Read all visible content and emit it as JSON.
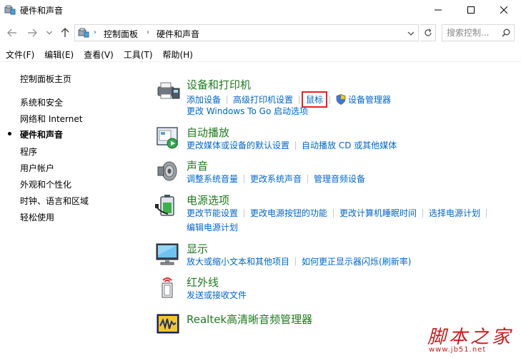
{
  "window": {
    "title": "硬件和声音"
  },
  "address": {
    "crumbs": [
      "控制面板",
      "硬件和声音"
    ],
    "search_placeholder": "搜索控制..."
  },
  "menu": [
    "文件(F)",
    "编辑(E)",
    "查看(V)",
    "工具(T)",
    "帮助(H)"
  ],
  "sidebar": {
    "home": "控制面板主页",
    "items": [
      {
        "label": "系统和安全"
      },
      {
        "label": "网络和 Internet"
      },
      {
        "label": "硬件和声音",
        "active": true
      },
      {
        "label": "程序"
      },
      {
        "label": "用户帐户"
      },
      {
        "label": "外观和个性化"
      },
      {
        "label": "时钟、语言和区域"
      },
      {
        "label": "轻松使用"
      }
    ]
  },
  "categories": [
    {
      "title": "设备和打印机",
      "icon": "printer-icon",
      "rows": [
        [
          "添加设备",
          "高级打印机设置",
          "鼠标",
          "设备管理器"
        ],
        [
          "更改 Windows To Go 启动选项"
        ]
      ],
      "highlighted": "鼠标"
    },
    {
      "title": "自动播放",
      "icon": "autoplay-icon",
      "rows": [
        [
          "更改媒体或设备的默认设置",
          "自动播放 CD 或其他媒体"
        ]
      ]
    },
    {
      "title": "声音",
      "icon": "speaker-icon",
      "rows": [
        [
          "调整系统音量",
          "更改系统声音",
          "管理音频设备"
        ]
      ]
    },
    {
      "title": "电源选项",
      "icon": "battery-icon",
      "rows": [
        [
          "更改节能设置",
          "更改电源按钮的功能",
          "更改计算机睡眠时间",
          "选择电源计划"
        ],
        [
          "编辑电源计划"
        ]
      ]
    },
    {
      "title": "显示",
      "icon": "monitor-icon",
      "rows": [
        [
          "放大或缩小文本和其他项目",
          "如何更正显示器闪烁(刷新率)"
        ]
      ]
    },
    {
      "title": "红外线",
      "icon": "infrared-icon",
      "rows": [
        [
          "发送或接收文件"
        ]
      ]
    },
    {
      "title": "Realtek高清晰音频管理器",
      "icon": "realtek-icon",
      "rows": []
    }
  ],
  "watermark": {
    "text": "脚本之家",
    "url": "www.jb51.net"
  },
  "colors": {
    "heading": "#1e7b1e",
    "link": "#0066cc",
    "highlight": "#e8202a",
    "watermark": "#c91d1d"
  }
}
